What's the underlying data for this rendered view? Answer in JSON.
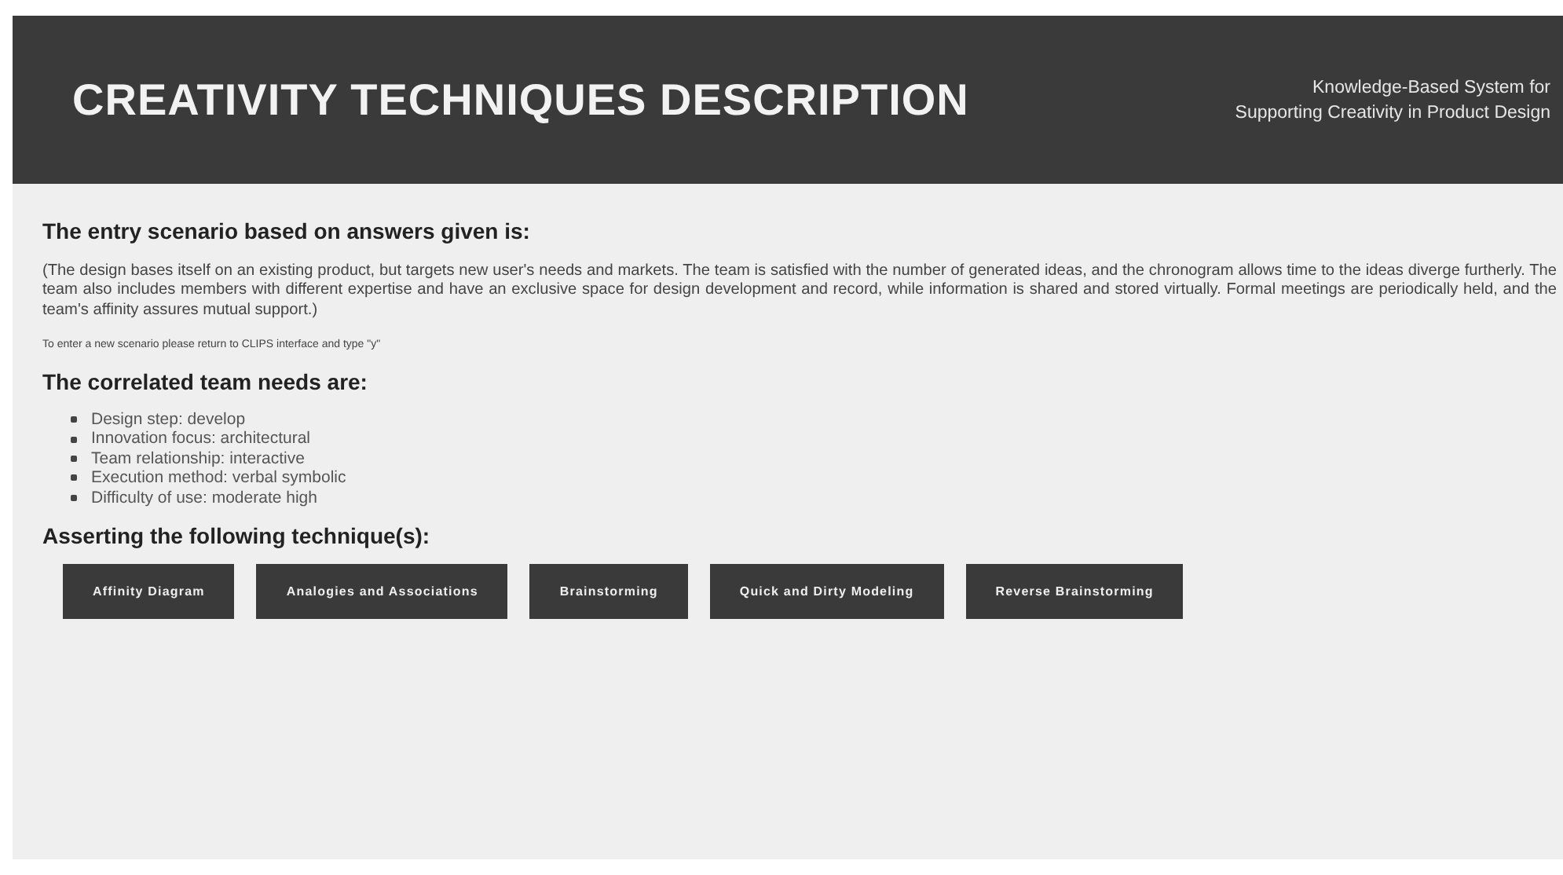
{
  "header": {
    "title": "CREATIVITY TECHNIQUES DESCRIPTION",
    "subtitle_lines": [
      "Knowledge-Based System for",
      "Supporting Creativity in Product Design"
    ]
  },
  "scenario": {
    "heading": "The entry scenario based on answers given is:",
    "text": "(The design bases itself on an existing product, but targets new user's needs and markets. The team is satisfied with the number of generated ideas, and the chronogram allows time to the ideas diverge furtherly. The team also includes members with different expertise and have an exclusive space for design development and record, while information is shared and stored virtually. Formal meetings are periodically held, and the team's affinity assures mutual support.)",
    "note": "To enter a new scenario please return to CLIPS interface and type \"y\""
  },
  "needs": {
    "heading": "The correlated team needs are:",
    "items": [
      "Design step: develop",
      "Innovation focus: architectural",
      "Team relationship: interactive",
      "Execution method: verbal symbolic",
      "Difficulty of use: moderate high"
    ]
  },
  "techniques": {
    "heading": "Asserting the following technique(s):",
    "buttons": [
      "Affinity Diagram",
      "Analogies and Associations",
      "Brainstorming",
      "Quick and Dirty Modeling",
      "Reverse Brainstorming"
    ]
  }
}
